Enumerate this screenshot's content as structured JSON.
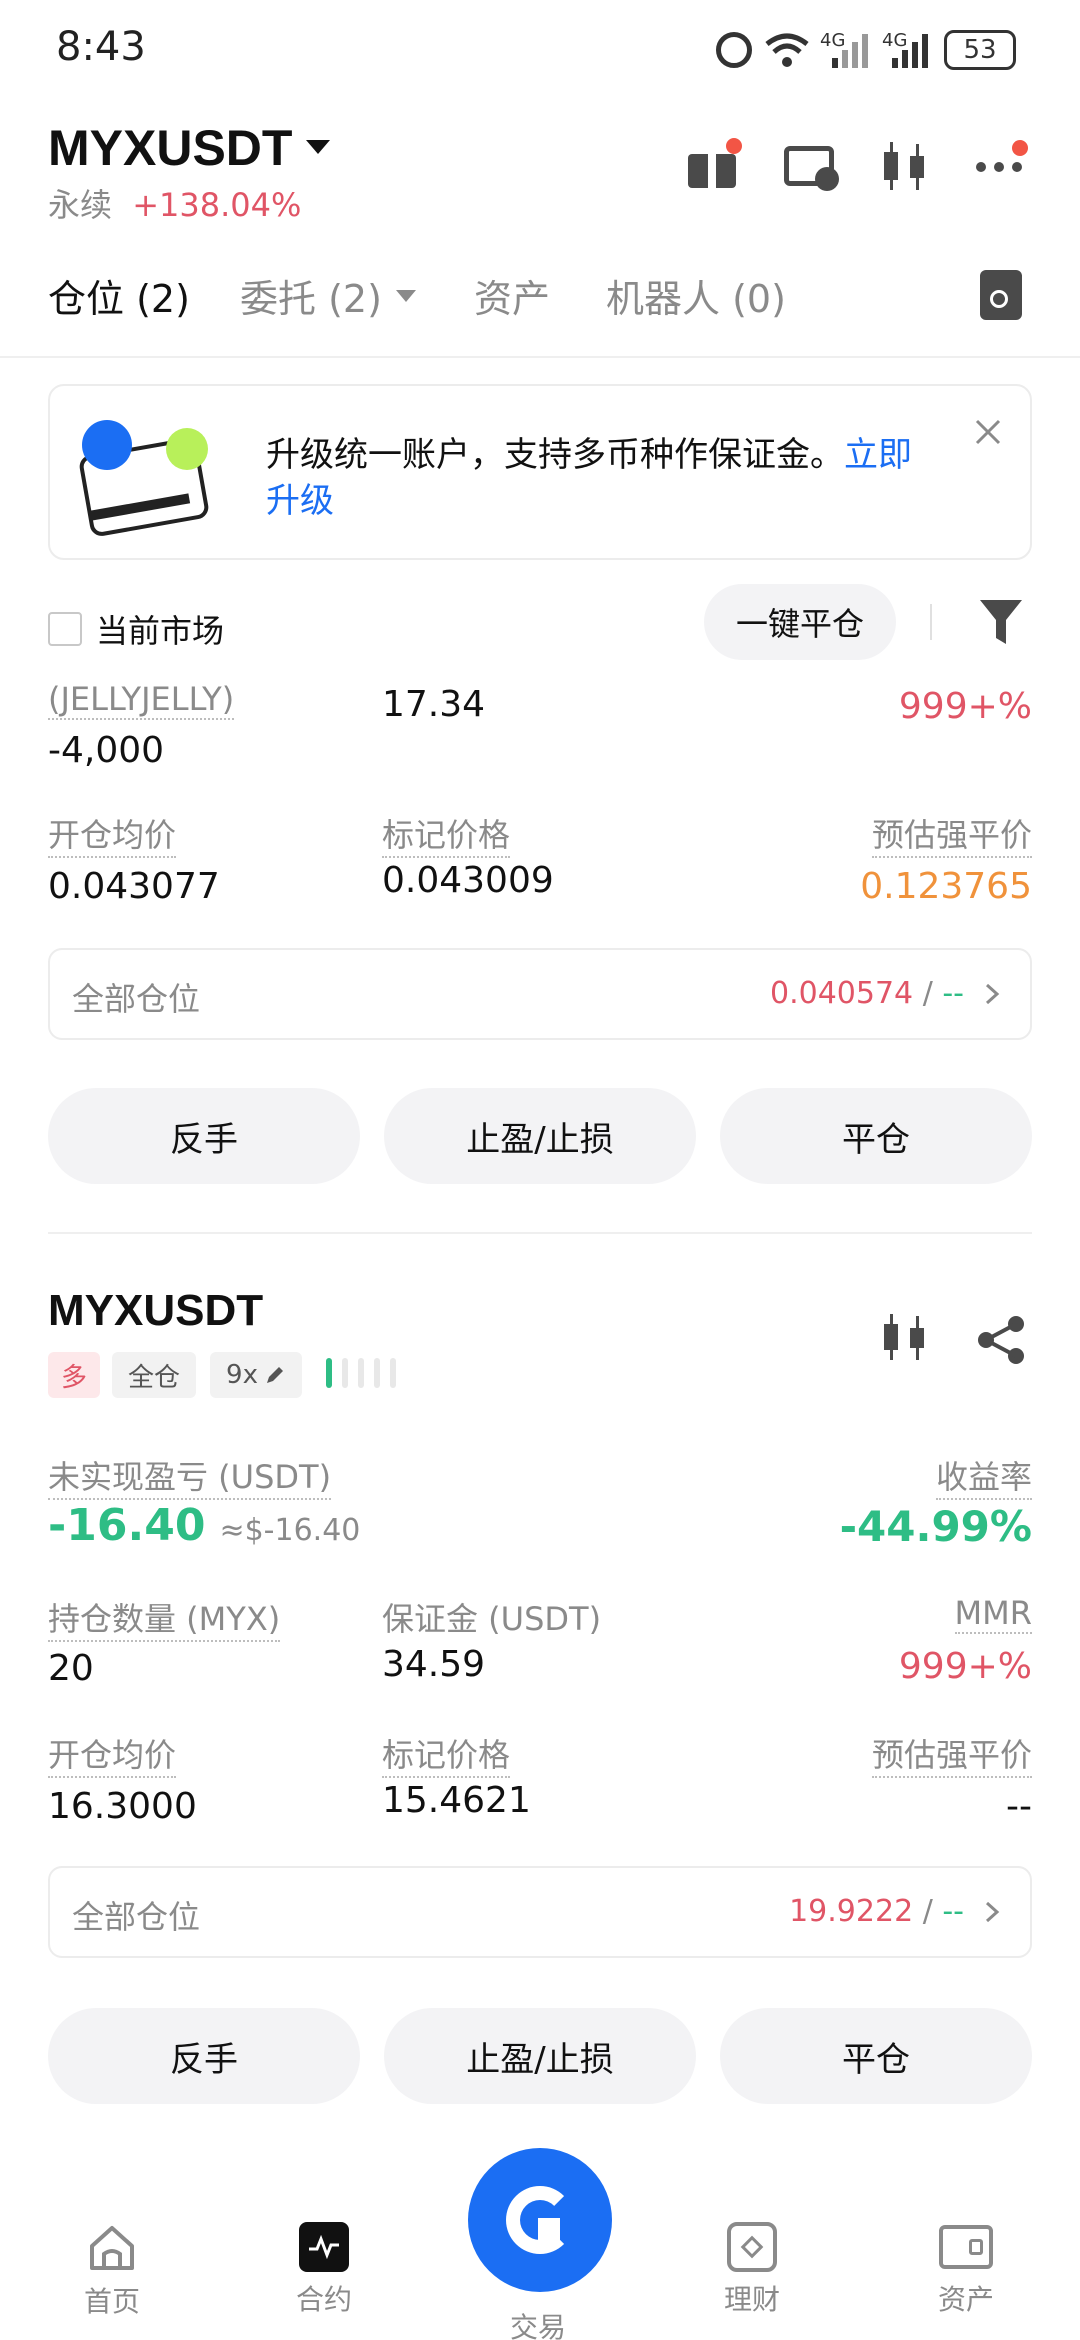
{
  "status_bar": {
    "time": "8:43",
    "battery": "53"
  },
  "header": {
    "symbol": "MYXUSDT",
    "subtitle": "永续",
    "change": "+138.04%",
    "colors": {
      "up": "#e05566",
      "down": "#2ebd85",
      "accent": "#1b6ef3"
    }
  },
  "tabs": [
    {
      "label": "仓位 (2)"
    },
    {
      "label": "委托 (2)"
    },
    {
      "label": "资产"
    },
    {
      "label": "机器人 (0)"
    }
  ],
  "banner": {
    "text": "升级统一账户，支持多币种作保证金。",
    "link_part1": "立即",
    "link_part2": "升级"
  },
  "filter": {
    "current_market_label": "当前市场",
    "close_all_label": "一键平仓"
  },
  "position1": {
    "symbol_partial": "(JELLYJELLY)",
    "qty": "-4,000",
    "margin": "17.34",
    "mmr": "999+%",
    "entry_label": "开仓均价",
    "entry": "0.043077",
    "mark_label": "标记价格",
    "mark": "0.043009",
    "liq_label": "预估强平价",
    "liq": "0.123765",
    "all_label": "全部仓位",
    "all_value": "0.040574",
    "all_sep": " / ",
    "all_dash": "--",
    "btn_reverse": "反手",
    "btn_tpsl": "止盈/止损",
    "btn_close": "平仓"
  },
  "position2": {
    "symbol": "MYXUSDT",
    "tag_side": "多",
    "tag_mode": "全仓",
    "tag_leverage": "9x",
    "pnl_label": "未实现盈亏 (USDT)",
    "pnl": "-16.40",
    "pnl_usd": "≈$-16.40",
    "roe_label": "收益率",
    "roe": "-44.99%",
    "qty_label": "持仓数量 (MYX)",
    "qty": "20",
    "margin_label": "保证金 (USDT)",
    "margin": "34.59",
    "mmr_label": "MMR",
    "mmr": "999+%",
    "entry_label": "开仓均价",
    "entry": "16.3000",
    "mark_label": "标记价格",
    "mark": "15.4621",
    "liq_label": "预估强平价",
    "liq": "--",
    "all_label": "全部仓位",
    "all_value": "19.9222",
    "all_sep": " / ",
    "all_dash": "--",
    "btn_reverse": "反手",
    "btn_tpsl": "止盈/止损",
    "btn_close": "平仓"
  },
  "bottom_nav": [
    {
      "label": "首页",
      "icon": "home-icon"
    },
    {
      "label": "合约",
      "icon": "futures-icon"
    },
    {
      "label": "交易",
      "icon": "trade-icon"
    },
    {
      "label": "理财",
      "icon": "earn-icon"
    },
    {
      "label": "资产",
      "icon": "wallet-icon"
    }
  ]
}
